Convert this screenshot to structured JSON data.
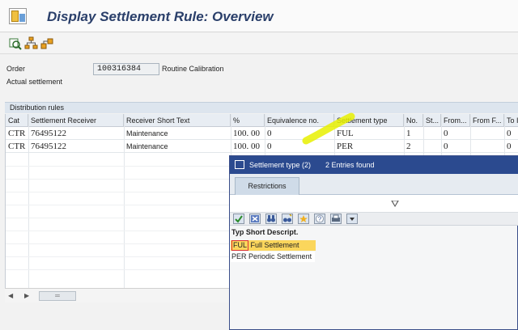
{
  "window": {
    "title": "Display Settlement Rule: Overview"
  },
  "toolbar": {
    "items": [
      {
        "icon": "display-object-icon"
      },
      {
        "icon": "hierarchy-icon"
      },
      {
        "icon": "structure-icon"
      }
    ]
  },
  "header": {
    "order_label": "Order",
    "order_value": "100316384",
    "order_description": "Routine Calibration",
    "settlement_label": "Actual settlement"
  },
  "distribution": {
    "title": "Distribution rules",
    "columns": [
      "Cat",
      "Settlement Receiver",
      "Receiver Short Text",
      "%",
      "Equivalence no.",
      "Settlement type",
      "No.",
      "St...",
      "From...",
      "From F...",
      "To I"
    ],
    "rows": [
      {
        "cat": "CTR",
        "receiver": "76495122",
        "short_text": "Maintenance",
        "percent": "100. 00",
        "equivalence": "0",
        "settlement_type": "FUL",
        "no": "1",
        "status": "",
        "from1": "0",
        "from2": "",
        "to": "0"
      },
      {
        "cat": "CTR",
        "receiver": "76495122",
        "short_text": "Maintenance",
        "percent": "100. 00",
        "equivalence": "0",
        "settlement_type": "PER",
        "no": "2",
        "status": "",
        "from1": "0",
        "from2": "",
        "to": "0"
      }
    ]
  },
  "popup": {
    "title": "Settlement type (2)",
    "count": "2 Entries found",
    "tab": "Restrictions",
    "list_header": "Typ Short Descript.",
    "entries": [
      {
        "code": "FUL",
        "description": "Full Settlement",
        "selected": true
      },
      {
        "code": "PER",
        "description": "Periodic Settlement",
        "selected": false
      }
    ],
    "toolbar_icons": [
      "check-icon",
      "cancel-icon",
      "binoculars-icon",
      "new-search-icon",
      "favorite-add-icon",
      "help-icon",
      "print-icon"
    ]
  },
  "colors": {
    "title": "#2a3f6a",
    "popup_title_bg": "#2b4a8f",
    "selection": "#fbd65c",
    "highlighter": "#e8f000"
  }
}
